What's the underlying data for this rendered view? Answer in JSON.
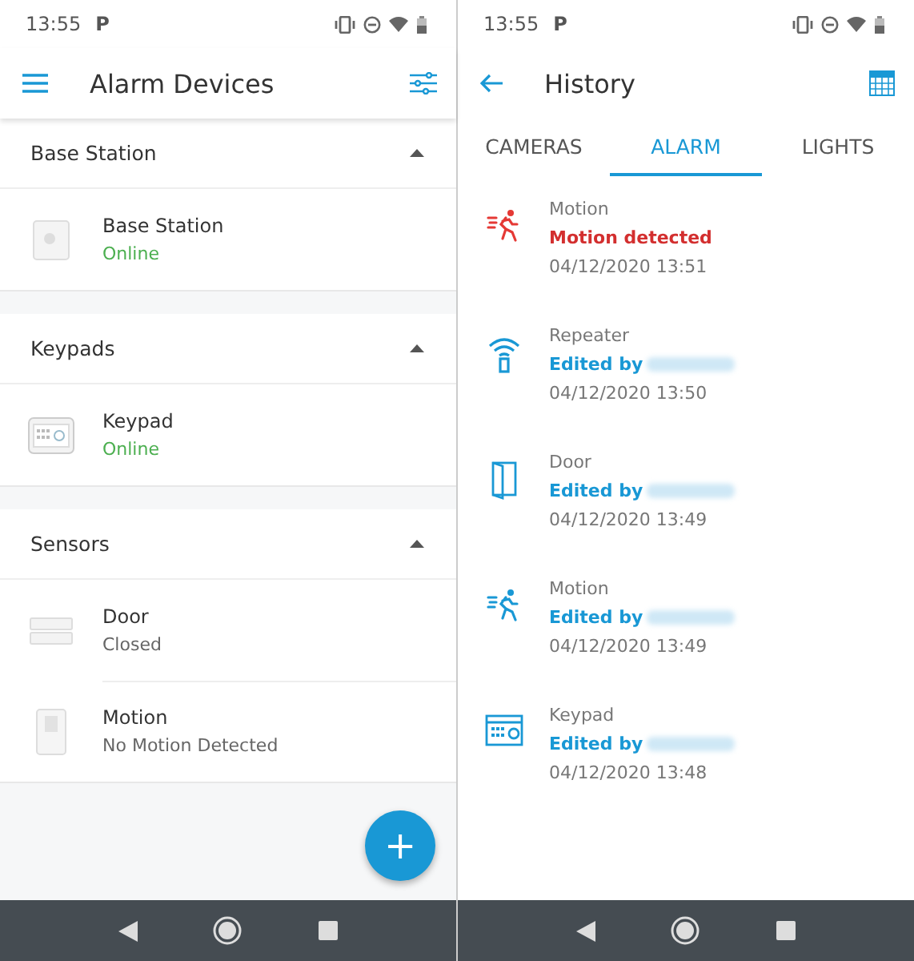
{
  "devices_screen": {
    "status_bar": {
      "time": "13:55",
      "app_letter": "P"
    },
    "title": "Alarm Devices",
    "groups": [
      {
        "title": "Base Station",
        "expanded": true,
        "devices": [
          {
            "kind": "base",
            "name": "Base Station",
            "status": "Online",
            "online": true
          }
        ]
      },
      {
        "title": "Keypads",
        "expanded": true,
        "devices": [
          {
            "kind": "keypad",
            "name": "Keypad",
            "status": "Online",
            "online": true
          }
        ]
      },
      {
        "title": "Sensors",
        "expanded": true,
        "devices": [
          {
            "kind": "door",
            "name": "Door",
            "status": "Closed",
            "online": false
          },
          {
            "kind": "motion",
            "name": "Motion",
            "status": "No Motion Detected",
            "online": false
          }
        ]
      }
    ],
    "fab": "+"
  },
  "history_screen": {
    "status_bar": {
      "time": "13:55",
      "app_letter": "P"
    },
    "title": "History",
    "tabs": [
      {
        "label": "CAMERAS",
        "selected": false
      },
      {
        "label": "ALARM",
        "selected": true
      },
      {
        "label": "LIGHTS",
        "selected": false
      }
    ],
    "events": [
      {
        "kind": "motion",
        "device": "Motion",
        "message": "Motion detected",
        "alert": true,
        "redacted_user": false,
        "time": "04/12/2020 13:51"
      },
      {
        "kind": "repeater",
        "device": "Repeater",
        "message": "Edited by",
        "alert": false,
        "redacted_user": true,
        "time": "04/12/2020 13:50"
      },
      {
        "kind": "door",
        "device": "Door",
        "message": "Edited by",
        "alert": false,
        "redacted_user": true,
        "time": "04/12/2020 13:49"
      },
      {
        "kind": "motion",
        "device": "Motion",
        "message": "Edited by",
        "alert": false,
        "redacted_user": true,
        "time": "04/12/2020 13:49"
      },
      {
        "kind": "keypad",
        "device": "Keypad",
        "message": "Edited by",
        "alert": false,
        "redacted_user": true,
        "time": "04/12/2020 13:48"
      }
    ]
  }
}
